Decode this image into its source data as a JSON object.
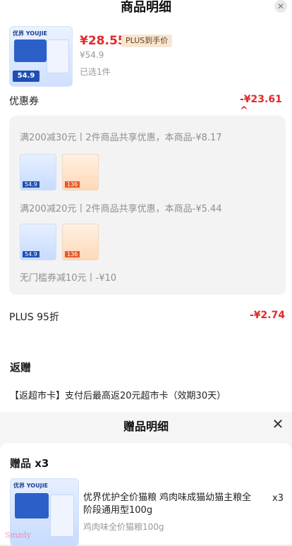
{
  "header": {
    "title": "商品明细"
  },
  "product": {
    "price": "¥28.55",
    "plus_tag": "PLUS到手价",
    "orig_price": "¥54.9",
    "selected": "已选1件",
    "brand": "优界 YOUJIE",
    "badge": "54.9"
  },
  "coupon": {
    "label": "优惠券",
    "value": "-¥23.61 ^",
    "items": [
      {
        "text": "满200减30元丨2件商品共享优惠，本商品-¥8.17",
        "thumb_a_price": "54.9",
        "thumb_b_price": "136"
      },
      {
        "text": "满200减20元丨2件商品共享优惠，本商品-¥5.44",
        "thumb_a_price": "54.9",
        "thumb_b_price": "136"
      },
      {
        "text": "无门槛券减10元丨-¥10"
      }
    ]
  },
  "plus": {
    "label": "PLUS 95折",
    "value": "-¥2.74"
  },
  "rebate": {
    "title": "返赠",
    "text": "【返超市卡】支付后最高返20元超市卡（效期30天）"
  },
  "gift_sheet": {
    "title": "赠品明细",
    "heading": "赠品 x3",
    "item_name": "优界优护全价猫粮 鸡肉味成猫幼猫主粮全阶段通用型100g",
    "item_spec": "鸡肉味全价猫粮100g",
    "qty": "x3"
  },
  "watermark": "Smzdy",
  "colors": {
    "accent_red": "#e12a2a",
    "plus_tag_bg": "#f7e6d3"
  },
  "icons": [
    "close-icon",
    "chevron-up-icon"
  ]
}
